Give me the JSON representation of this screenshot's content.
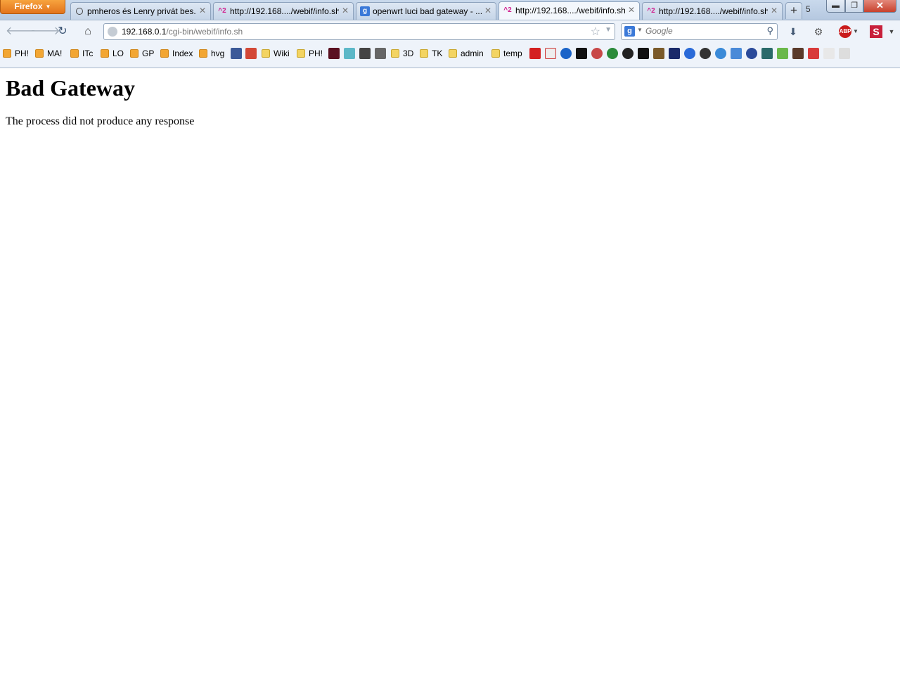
{
  "browser": {
    "app_button": "Firefox",
    "tabs": [
      {
        "label": "pmheros és Lenry privát bes...",
        "favicon": "search-icon",
        "active": false
      },
      {
        "label": "http://192.168..../webif/info.sh",
        "favicon_text": "^2",
        "active": false
      },
      {
        "label": "openwrt luci bad gateway - ...",
        "favicon": "google-icon",
        "active": false
      },
      {
        "label": "http://192.168..../webif/info.sh",
        "favicon_text": "^2",
        "active": true
      },
      {
        "label": "http://192.168..../webif/info.sh",
        "favicon_text": "^2",
        "active": false
      }
    ],
    "tab_count": "5",
    "url_host": "192.168.0.1",
    "url_path": "/cgi-bin/webif/info.sh",
    "search_placeholder": "Google",
    "search_engine_letter": "g",
    "addon_button_label": "ABP",
    "s_button_label": "S"
  },
  "bookmarks": [
    {
      "label": "PH!",
      "type": "rss"
    },
    {
      "label": "MA!",
      "type": "rss"
    },
    {
      "label": "ITc",
      "type": "rss"
    },
    {
      "label": "LO",
      "type": "rss"
    },
    {
      "label": "GP",
      "type": "rss"
    },
    {
      "label": "Index",
      "type": "rss"
    },
    {
      "label": "hvg",
      "type": "rss"
    },
    {
      "label": "Wiki",
      "type": "folder"
    },
    {
      "label": "PH!",
      "type": "folder"
    },
    {
      "label": "3D",
      "type": "folder"
    },
    {
      "label": "TK",
      "type": "folder"
    },
    {
      "label": "admin",
      "type": "folder"
    },
    {
      "label": "temp",
      "type": "folder"
    }
  ],
  "page": {
    "heading": "Bad Gateway",
    "message": "The process did not produce any response"
  },
  "colors": {
    "firefox_button": "#e8822a",
    "titlebar": "#c0d2e8",
    "toolbar": "#eef3fa",
    "close_button": "#c8412d"
  }
}
